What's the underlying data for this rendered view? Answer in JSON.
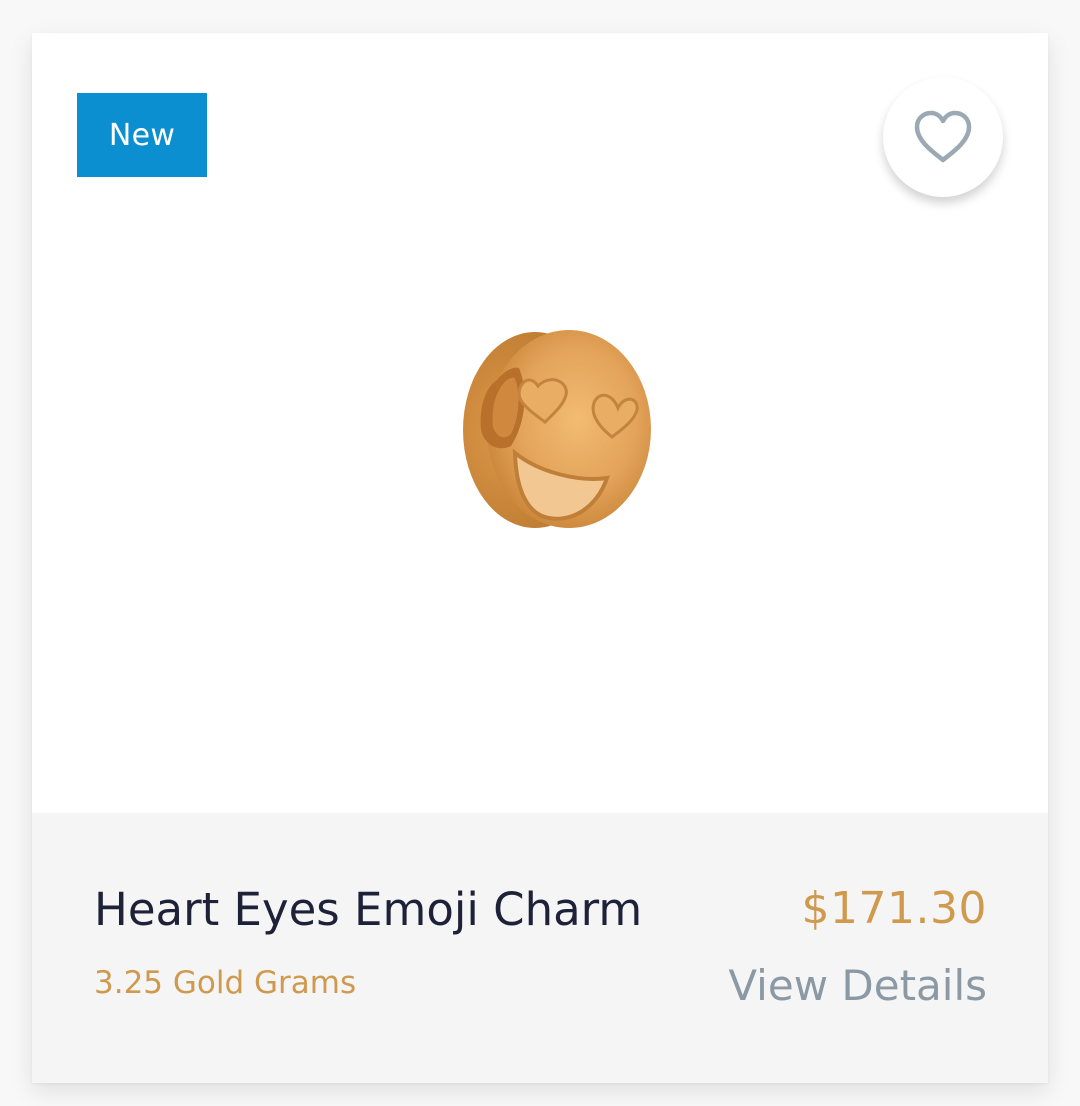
{
  "card": {
    "badge": "New",
    "favorite_icon": "heart-outline-icon",
    "product_image": "heart-eyes-emoji-charm",
    "title": "Heart Eyes Emoji Charm",
    "weight": "3.25 Gold Grams",
    "price": "$171.30",
    "details_link": "View Details"
  },
  "colors": {
    "badge_bg": "#0b8fd1",
    "gold": "#cf9a4e",
    "title": "#1d2238",
    "muted": "#8a99a4",
    "info_bg": "#f5f5f6"
  }
}
